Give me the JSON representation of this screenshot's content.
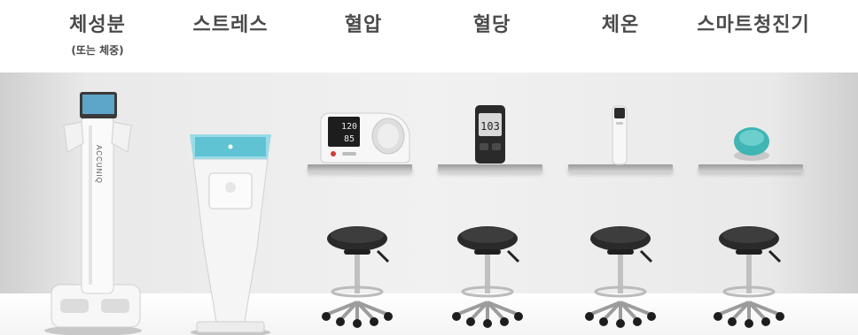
{
  "categories": [
    {
      "id": "body-composition",
      "label": "체성분",
      "sublabel": "(또는 체중)"
    },
    {
      "id": "stress",
      "label": "스트레스"
    },
    {
      "id": "blood-pressure",
      "label": "혈압"
    },
    {
      "id": "blood-glucose",
      "label": "혈당"
    },
    {
      "id": "body-temperature",
      "label": "체온"
    },
    {
      "id": "smart-stethoscope",
      "label": "스마트청진기"
    }
  ],
  "devices": {
    "body_composition_brand": "ACCUNIQ",
    "bp_monitor": {
      "systolic": "120",
      "diastolic": "85"
    },
    "glucose_meter": {
      "reading": "103"
    }
  },
  "colors": {
    "wall": "#eeeeee",
    "device_white": "#f6f6f6",
    "stool_seat": "#2a2a2a",
    "screen_teal": "#5fc3d4",
    "stethoscope_teal": "#3fb5b4",
    "text": "#4a4a4a"
  }
}
